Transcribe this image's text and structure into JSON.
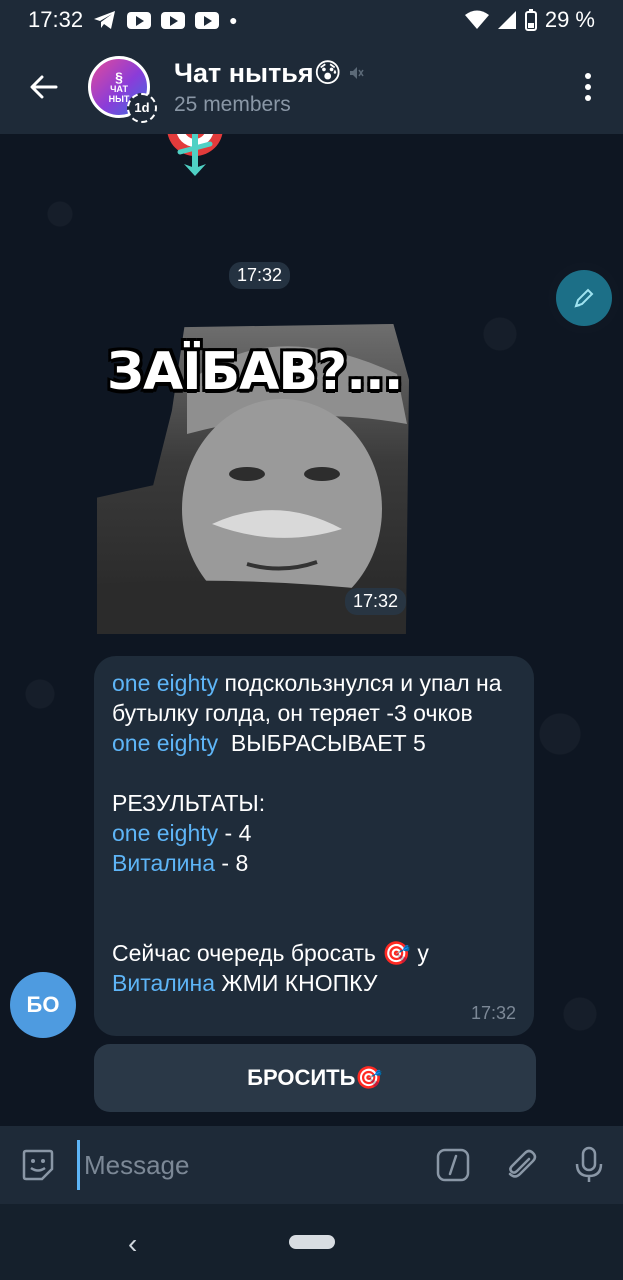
{
  "status_bar": {
    "time": "17:32",
    "battery": "29 %"
  },
  "header": {
    "title": "Чат нытья😰",
    "subtitle": "25 members",
    "avatar_text_line1": "ЧАТ",
    "avatar_text_line2": "НЫТ",
    "timer_badge": "1d"
  },
  "messages": {
    "time_pill": "17:32",
    "sticker_caption": "ЗАЇБАВ?...",
    "sticker_time": "17:32",
    "bubble": {
      "name1": "one eighty",
      "text1": " подскользнулся и упал на бутылку голда, он теряет -3 очков",
      "name2": "one eighty",
      "text2": "  ВЫБРАСЫВАЕТ 5",
      "results_label": "РЕЗУЛЬТАТЫ:",
      "name3": "one eighty",
      "score1": " - 4",
      "name4": "Виталина",
      "score2": " - 8",
      "turn_text": "Сейчас очередь бросать 🎯 у",
      "name5": "Виталина",
      "press_text": " ЖМИ КНОПКУ",
      "time": "17:32"
    },
    "sender_initials": "БО",
    "inline_button_label": "БРОСИТЬ🎯"
  },
  "input": {
    "placeholder": "Message"
  },
  "colors": {
    "accent": "#5eb5f7",
    "header_bg": "#1e2a38",
    "bubble_bg": "#1f2c3a",
    "avatar_bg": "#4e9be0"
  },
  "icons": [
    "telegram-icon",
    "youtube-icon",
    "wifi-icon",
    "signal-icon",
    "battery-icon",
    "back-arrow-icon",
    "muted-icon",
    "more-vert-icon",
    "pencil-icon",
    "dart-icon",
    "sticker-emoji-icon",
    "command-icon",
    "attach-icon",
    "mic-icon"
  ]
}
